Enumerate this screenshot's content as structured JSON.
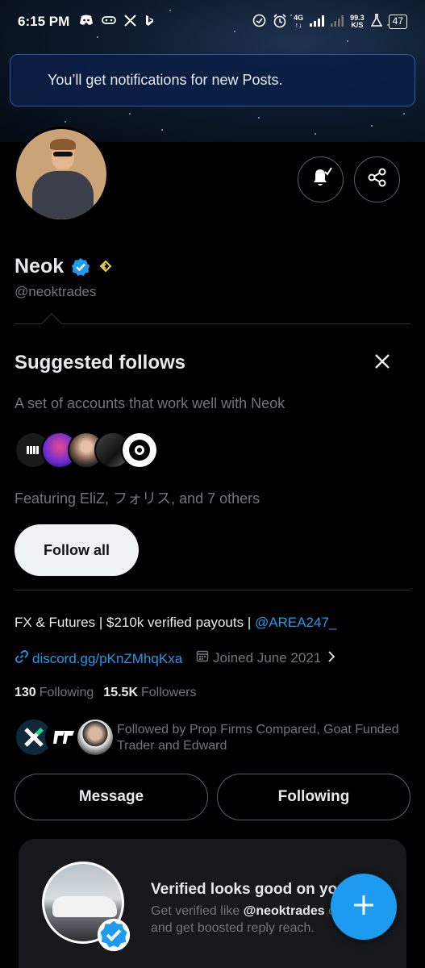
{
  "status_bar": {
    "time": "6:15 PM",
    "left_icons": [
      "discord-icon",
      "gamepad-icon",
      "x-icon",
      "bing-icon"
    ],
    "net_top": "4G",
    "speed_value": "99.3",
    "speed_unit": "K/S",
    "battery": "47"
  },
  "toast": {
    "text": "You’ll get notifications for new Posts."
  },
  "profile": {
    "name": "Neok",
    "handle": "@neoktrades",
    "bio_prefix": "FX & Futures | $210k verified payouts | ",
    "bio_mention": "@AREA247_",
    "link": "discord.gg/pKnZMhqKxa",
    "joined": "Joined June 2021",
    "following_count": "130",
    "following_label": "Following",
    "followers_count": "15.5K",
    "followers_label": "Followers",
    "followed_by": "Followed by Prop Firms Compared, Goat Funded Trader and Edward"
  },
  "suggested": {
    "title": "Suggested follows",
    "description": "A set of accounts that work well with Neok",
    "featuring": "Featuring EliZ, フォリス, and 7 others",
    "follow_all": "Follow all"
  },
  "actions": {
    "message": "Message",
    "following": "Following"
  },
  "promo": {
    "title": "Verified looks good on you",
    "desc_prefix": "Get verified like ",
    "desc_handle": "@neoktrades",
    "desc_suffix": " out and get boosted reply reach."
  },
  "colors": {
    "accent": "#1d9bf0",
    "muted": "#71767b",
    "border": "#2f3336"
  }
}
